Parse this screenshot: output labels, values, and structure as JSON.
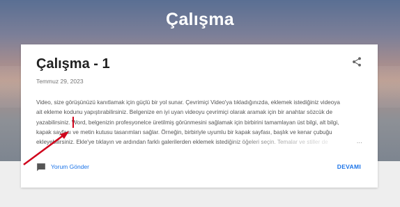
{
  "blog": {
    "title": "Çalışma"
  },
  "post": {
    "title": "Çalışma - 1",
    "date": "Temmuz 29, 2023",
    "snippet_lines": [
      " Video, size görüşünüzü kanıtlamak için güçlü bir yol sunar. Çevrimiçi Video'ya tıkladığınızda, eklemek istediğiniz videoya",
      "ait ekleme kodunu yapıştırabilirsiniz. Belgenize en iyi uyan videoyu çevrimiçi olarak aramak için bir anahtar sözcük de",
      "yazabilirsiniz. Word, belgenizin profesyonelce üretilmiş görünmesini sağlamak için birbirini tamamlayan üst bilgi, alt bilgi,",
      "kapak sayfası ve metin kutusu tasarımları sağlar. Örneğin, birbiriyle uyumlu bir kapak sayfası, başlık ve kenar çubuğu",
      "ekleyebilirsiniz. Ekle'ye tıklayın ve ardından farklı galerilerden eklemek istediğiniz öğeleri seçin. Temalar ve stiller de"
    ],
    "ellipsis": "…",
    "comment_link": "Yorum Gönder",
    "more_link": "DEVAMI"
  },
  "icons": {
    "share": "share-icon",
    "comment": "comment-icon"
  },
  "colors": {
    "link": "#1a73e8",
    "arrow": "#d0021b",
    "title": "#212121"
  }
}
